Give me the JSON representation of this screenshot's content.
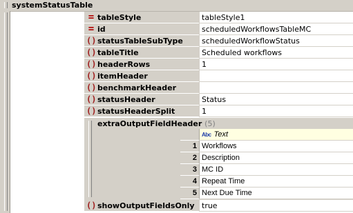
{
  "root": {
    "label": "systemStatusTable"
  },
  "attributes": [
    {
      "icon": "attribute-icon",
      "symbol": "=",
      "name": "tableStyle",
      "value": "tableStyle1"
    },
    {
      "icon": "attribute-icon",
      "symbol": "=",
      "name": "id",
      "value": "scheduledWorkflowsTableMC"
    },
    {
      "icon": "element-icon",
      "symbol": "()",
      "name": "statusTableSubType",
      "value": "scheduledWorkflowStatus"
    },
    {
      "icon": "element-icon",
      "symbol": "()",
      "name": "tableTitle",
      "value": "Scheduled workflows"
    },
    {
      "icon": "element-icon",
      "symbol": "()",
      "name": "headerRows",
      "value": "1"
    },
    {
      "icon": "element-icon",
      "symbol": "()",
      "name": "itemHeader",
      "value": ""
    },
    {
      "icon": "element-icon",
      "symbol": "()",
      "name": "benchmarkHeader",
      "value": ""
    },
    {
      "icon": "element-icon",
      "symbol": "()",
      "name": "statusHeader",
      "value": "Status"
    },
    {
      "icon": "element-icon",
      "symbol": "()",
      "name": "statusHeaderSplit",
      "value": "1"
    }
  ],
  "extra": {
    "name": "extraOutputFieldHeader",
    "count": "(5)",
    "column_icon": "Abc",
    "column_header": "Text",
    "rows": [
      {
        "index": "1",
        "value": "Workflows"
      },
      {
        "index": "2",
        "value": "Description"
      },
      {
        "index": "3",
        "value": "MC ID"
      },
      {
        "index": "4",
        "value": "Repeat Time"
      },
      {
        "index": "5",
        "value": "Next Due Time"
      }
    ]
  },
  "last": {
    "icon": "element-icon",
    "symbol": "()",
    "name": "showOutputFieldsOnly",
    "value": "true"
  }
}
